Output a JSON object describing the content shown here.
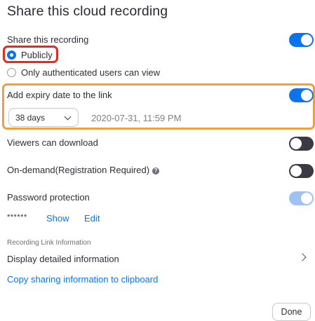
{
  "dialog": {
    "title": "Share this cloud recording"
  },
  "share_recording": {
    "label": "Share this recording",
    "toggle_state": "on",
    "options": [
      {
        "label": "Publicly",
        "selected": true
      },
      {
        "label": "Only authenticated users can view",
        "selected": false
      }
    ]
  },
  "expiry": {
    "label": "Add expiry date to the link",
    "toggle_state": "on",
    "duration_selected": "38 days",
    "expiry_datetime": "2020-07-31, 11:59 PM"
  },
  "viewers_download": {
    "label": "Viewers can download",
    "toggle_state": "off"
  },
  "on_demand": {
    "label": "On-demand(Registration Required)",
    "help_icon": "?",
    "toggle_state": "off"
  },
  "password": {
    "label": "Password protection",
    "toggle_state": "on-disabled",
    "masked_value": "******",
    "show_label": "Show",
    "edit_label": "Edit"
  },
  "link_info": {
    "section_label": "Recording Link Information",
    "detail_label": "Display detailed information",
    "copy_label": "Copy sharing information to clipboard"
  },
  "footer": {
    "done_label": "Done"
  },
  "colors": {
    "accent": "#0e72ed",
    "highlight_red": "#e02c21",
    "highlight_orange": "#f0a03b",
    "toggle_off": "#3a3a45",
    "toggle_disabled": "#9ec2f3"
  }
}
